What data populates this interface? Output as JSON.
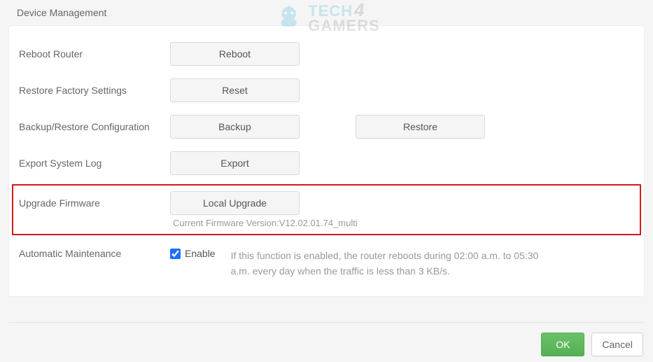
{
  "section_title": "Device Management",
  "rows": {
    "reboot": {
      "label": "Reboot Router",
      "button": "Reboot"
    },
    "reset": {
      "label": "Restore Factory Settings",
      "button": "Reset"
    },
    "backup": {
      "label": "Backup/Restore Configuration",
      "button_backup": "Backup",
      "button_restore": "Restore"
    },
    "export": {
      "label": "Export System Log",
      "button": "Export"
    },
    "upgrade": {
      "label": "Upgrade Firmware",
      "button": "Local Upgrade",
      "version_text": "Current Firmware Version:V12.02.01.74_multi"
    },
    "maintenance": {
      "label": "Automatic Maintenance",
      "checkbox_label": "Enable",
      "checked": true,
      "description": "If this function is enabled, the router reboots during 02:00 a.m. to 05:30 a.m. every day when the traffic is less than 3 KB/s."
    }
  },
  "footer": {
    "ok": "OK",
    "cancel": "Cancel"
  },
  "watermark": {
    "line1": "TECH",
    "four": "4",
    "line2": "GAMERS"
  }
}
